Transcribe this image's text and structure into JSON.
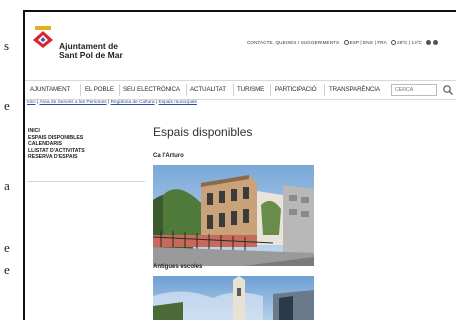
{
  "side_text": [
    "s",
    "e",
    "a",
    "e",
    "e"
  ],
  "brand": {
    "line1": "Ajuntament de",
    "line2": "Sant Pol de Mar"
  },
  "toplinks": {
    "contact": "CONTACTE, QUEIXES I SUGGERIMENTS",
    "languages": "ESP | ENG | FRA",
    "weather": "29ºC | 14ºC"
  },
  "nav": {
    "items": [
      "AJUNTAMENT",
      "EL POBLE",
      "SEU ELECTRÒNICA",
      "ACTUALITAT",
      "TURISME",
      "PARTICIPACIÓ",
      "TRANSPARÈNCIA"
    ],
    "search_placeholder": "CERCA"
  },
  "breadcrumb": {
    "items": [
      "Inici",
      "Àrea de Serveis a les Persones",
      "Regidoria de Cultura",
      "Espais municipals"
    ],
    "sep": " | "
  },
  "sidebar": {
    "items": [
      "INICI",
      "ESPAIS DISPONIBLES",
      "CALENDARIS",
      "LLISTAT D'ACTIVITATS",
      "RESERVA D'ESPAIS"
    ]
  },
  "main": {
    "title": "Espais disponibles",
    "spaces": [
      {
        "name": "Ca l'Arturo"
      },
      {
        "name": "Antigues escoles"
      }
    ]
  },
  "colors": {
    "nav_border": "#d8d8d8",
    "link": "#2a4d9a",
    "logo_red": "#d7262e",
    "logo_gold": "#e2b01f"
  }
}
